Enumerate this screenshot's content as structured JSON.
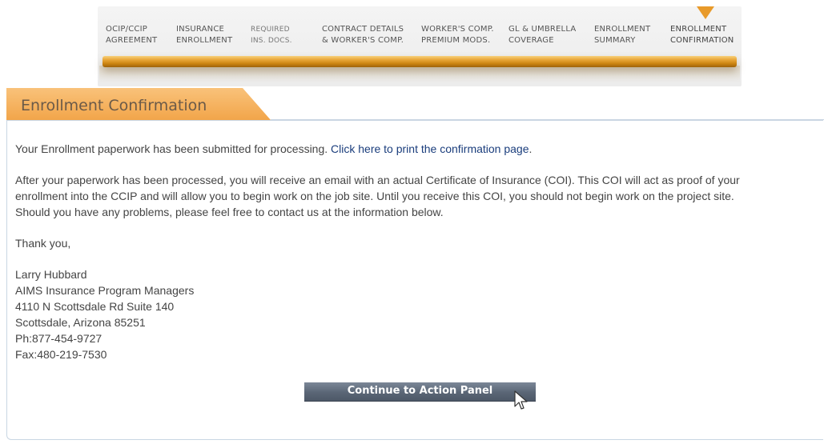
{
  "steps": [
    {
      "line1": "OCIP/CCIP",
      "line2": "AGREEMENT"
    },
    {
      "line1": "INSURANCE",
      "line2": "ENROLLMENT"
    },
    {
      "line1": "REQUIRED",
      "line2": "INS. DOCS."
    },
    {
      "line1": "CONTRACT DETAILS",
      "line2": "& WORKER'S COMP."
    },
    {
      "line1": "WORKER'S COMP.",
      "line2": "PREMIUM MODS."
    },
    {
      "line1": "GL & UMBRELLA",
      "line2": "COVERAGE"
    },
    {
      "line1": "ENROLLMENT",
      "line2": "SUMMARY"
    },
    {
      "line1": "ENROLLMENT",
      "line2": "CONFIRMATION"
    }
  ],
  "progress": {
    "current_step": 8,
    "total_steps": 8,
    "accent_color": "#e89a2a"
  },
  "panel": {
    "title": "Enrollment Confirmation"
  },
  "message": {
    "submitted_text": "Your Enrollment paperwork has been submitted for processing. ",
    "print_link": "Click here to print the confirmation page",
    "period": ".",
    "paragraph_line1": "After your paperwork has been processed, you will receive an email with an actual Certificate of Insurance (COI). This COI will act as proof of your",
    "paragraph_line2": "enrollment into the CCIP and will allow you to begin work on the job site. Until you receive this COI, you should not begin work on the project site.",
    "paragraph_line3": "Should you have any problems, please feel free to contact us at the information below.",
    "thanks": "Thank you,"
  },
  "signature": {
    "name": "Larry Hubbard",
    "company": "AIMS Insurance Program Managers",
    "address1": "4110 N Scottsdale Rd Suite 140",
    "address2": "Scottsdale, Arizona 85251",
    "phone": "Ph:877-454-9727",
    "fax": "Fax:480-219-7530"
  },
  "continue_button": {
    "label": "Continue to Action Panel"
  }
}
